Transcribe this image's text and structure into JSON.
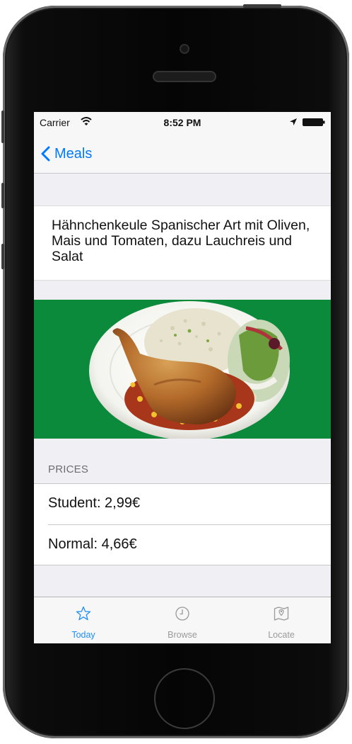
{
  "status_bar": {
    "carrier": "Carrier",
    "time": "8:52 PM"
  },
  "nav": {
    "back_label": "Meals"
  },
  "meal": {
    "title": "Hähnchenkeule Spanischer Art mit Oliven, Mais und Tomaten, dazu Lauchreis und Salat"
  },
  "prices": {
    "header": "PRICES",
    "student": "Student: 2,99€",
    "normal": "Normal: 4,66€"
  },
  "tabs": [
    {
      "label": "Today",
      "icon": "star-icon",
      "active": true
    },
    {
      "label": "Browse",
      "icon": "clock-icon",
      "active": false
    },
    {
      "label": "Locate",
      "icon": "map-icon",
      "active": false
    }
  ],
  "colors": {
    "accent": "#007aff",
    "tab_active": "#1e8ef5",
    "tab_inactive": "#9a9a9a",
    "plate_background": "#0a8a3a"
  }
}
